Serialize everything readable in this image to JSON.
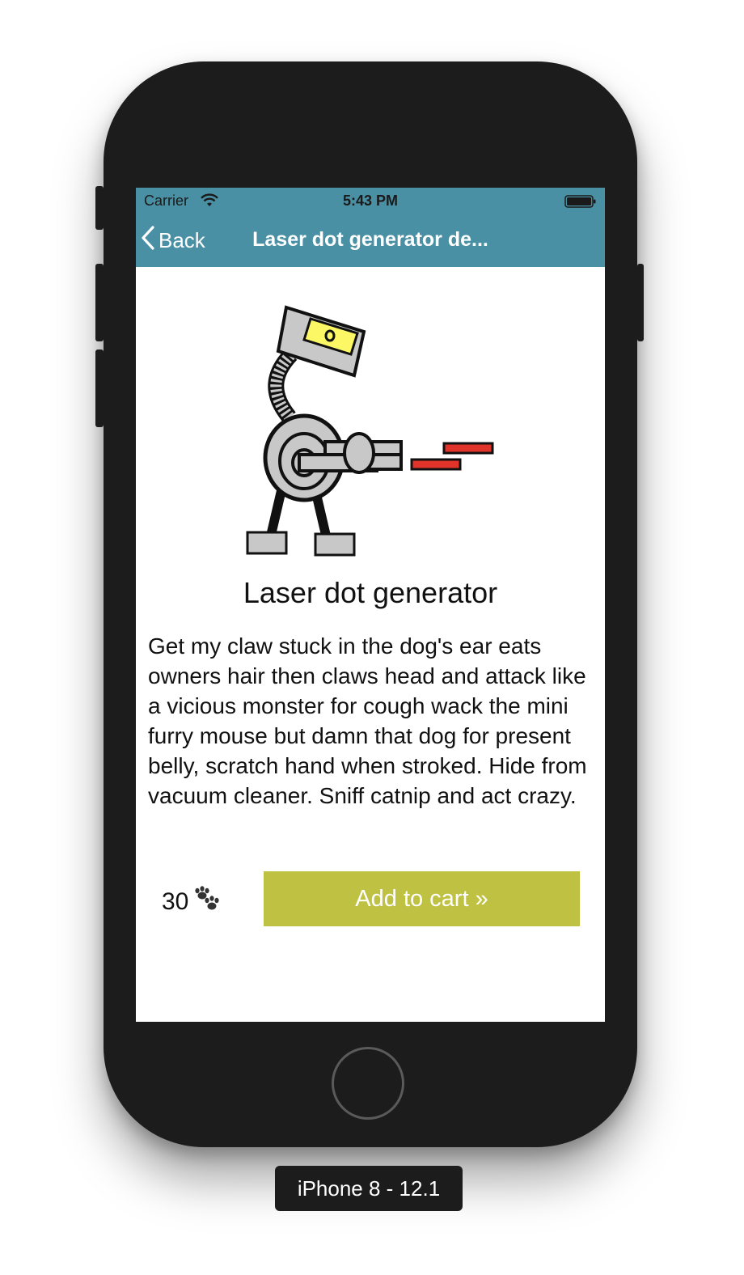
{
  "status_bar": {
    "carrier": "Carrier",
    "time": "5:43 PM"
  },
  "nav_bar": {
    "back_label": "Back",
    "title": "Laser dot generator de..."
  },
  "product": {
    "title": "Laser dot generator",
    "description": "Get my claw stuck in the dog's ear eats owners hair then claws head and attack like a vicious monster for cough wack the mini furry mouse but damn that dog for present belly, scratch hand when stroked. Hide from vacuum cleaner. Sniff catnip and act crazy.",
    "price": "30",
    "price_icon": "paw-prints-icon",
    "add_to_cart_label": "Add to cart »",
    "image_icon": "laser-robot-illustration"
  },
  "device": {
    "label": "iPhone 8 - 12.1"
  },
  "colors": {
    "nav_background": "#4a90a4",
    "button_background": "#bfc142",
    "laser_red": "#e0342a",
    "robot_yellow": "#fbf765",
    "robot_gray": "#c8c8c8"
  }
}
